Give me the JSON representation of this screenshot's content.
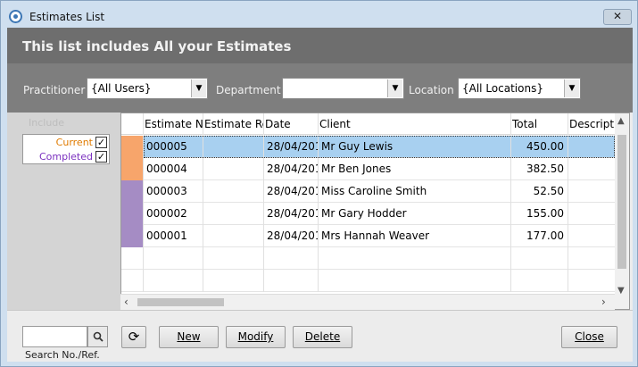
{
  "window": {
    "title": "Estimates List",
    "close_glyph": "✕",
    "icon": "app-logo-icon"
  },
  "banner": {
    "text": "This list includes All your Estimates"
  },
  "filters": {
    "practitioner": {
      "label": "Practitioner",
      "value": "{All Users}"
    },
    "department": {
      "label": "Department",
      "value": ""
    },
    "location": {
      "label": "Location",
      "value": "{All Locations}"
    }
  },
  "include": {
    "legend": "Include",
    "current": {
      "label": "Current",
      "checked": true,
      "color": "#e07b00"
    },
    "completed": {
      "label": "Completed",
      "checked": true,
      "color": "#7a2fbf"
    }
  },
  "grid": {
    "columns": [
      "Estimate No.",
      "Estimate Ref.",
      "Date",
      "Client",
      "Total",
      "Description"
    ],
    "rows": [
      {
        "status": "current",
        "no": "000005",
        "ref": "",
        "date": "28/04/201",
        "client": "Mr Guy Lewis",
        "total": "450.00",
        "desc": ""
      },
      {
        "status": "current",
        "no": "000004",
        "ref": "",
        "date": "28/04/201",
        "client": "Mr Ben Jones",
        "total": "382.50",
        "desc": ""
      },
      {
        "status": "completed",
        "no": "000003",
        "ref": "",
        "date": "28/04/201",
        "client": "Miss Caroline Smith",
        "total": "52.50",
        "desc": ""
      },
      {
        "status": "completed",
        "no": "000002",
        "ref": "",
        "date": "28/04/201",
        "client": "Mr Gary Hodder",
        "total": "155.00",
        "desc": ""
      },
      {
        "status": "completed",
        "no": "000001",
        "ref": "",
        "date": "28/04/201",
        "client": "Mrs Hannah Weaver",
        "total": "177.00",
        "desc": ""
      }
    ],
    "status_colors": {
      "current": "#f7a56b",
      "completed": "#a58cc4"
    },
    "selected_row": 0
  },
  "bottom": {
    "search": {
      "placeholder": "",
      "value": "",
      "label": "Search No./Ref."
    },
    "refresh_glyph": "⟳",
    "buttons": {
      "new": "New",
      "modify": "Modify",
      "delete": "Delete",
      "close": "Close"
    }
  }
}
